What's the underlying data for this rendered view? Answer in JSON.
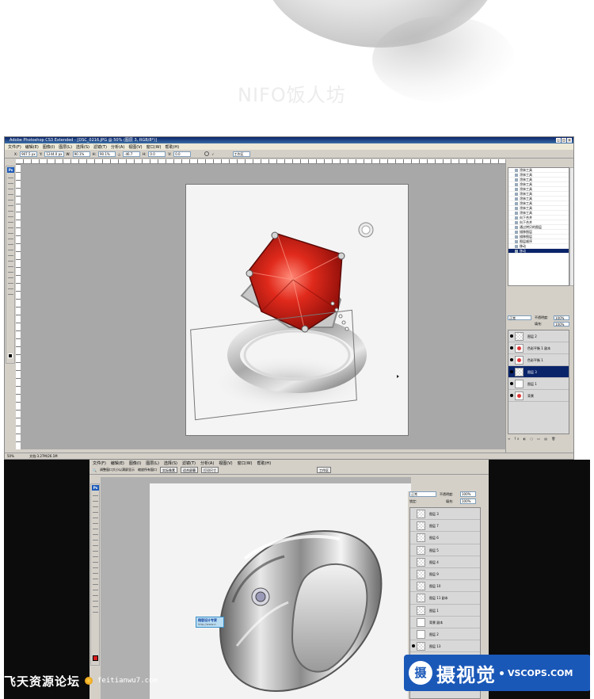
{
  "top": {
    "watermark": "NIFO饭人坊"
  },
  "ps1": {
    "title": "Adobe Photoshop CS3 Extended - [DSC_0216.JPG @ 50% (图层 3, RGB/8*)]",
    "menu": [
      "文件(F)",
      "编辑(E)",
      "图像(I)",
      "图层(L)",
      "选择(S)",
      "滤镜(T)",
      "分析(A)",
      "视图(V)",
      "窗口(W)",
      "帮助(H)"
    ],
    "options": {
      "x": "907.5 px",
      "y": "1244.0 px",
      "w": "90.1%",
      "h": "90.1%",
      "angle": "-46.7",
      "hskew": "0.0",
      "vskew": "0.0",
      "workspace": "工作区"
    },
    "history": [
      "涂抹工具",
      "涂抹工具",
      "涂抹工具",
      "涂抹工具",
      "涂抹工具",
      "涂抹工具",
      "涂抹工具",
      "涂抹工具",
      "涂抹工具",
      "涂抹工具",
      "向下合并",
      "向下合并",
      "通过拷贝的图层",
      "描移图层",
      "描移图层",
      "图层顺序",
      "移动",
      "移动"
    ],
    "layers_panel": {
      "blend_mode": "正常",
      "opacity_label": "不透明度:",
      "opacity": "100%",
      "fill_label": "填充:",
      "fill": "100%"
    },
    "layers": [
      {
        "name": "图层 2",
        "thumb": "check"
      },
      {
        "name": "色彩平衡 1 副本",
        "thumb": "red"
      },
      {
        "name": "色彩平衡 1",
        "thumb": "red"
      },
      {
        "name": "图层 3",
        "thumb": "check",
        "active": true
      },
      {
        "name": "图层 1",
        "thumb": "white"
      },
      {
        "name": "背景",
        "thumb": "red"
      }
    ],
    "status": {
      "zoom": "50%",
      "doc": "文档:3.27M/26.1M"
    }
  },
  "ps2": {
    "menu": [
      "文件(F)",
      "编辑(E)",
      "图像(I)",
      "图层(L)",
      "选择(S)",
      "滤镜(T)",
      "分析(A)",
      "视图(V)",
      "窗口(W)",
      "帮助(H)"
    ],
    "options": {
      "check1": "调整窗口大小以满屏显示",
      "check2": "缩放所有窗口",
      "btn1": "实际像素",
      "btn2": "适合屏幕",
      "btn3": "打印尺寸",
      "workspace": "工作区"
    },
    "callout": {
      "title": "翔容设计专家",
      "url": "http://www.rr"
    },
    "layers_panel": {
      "blend_mode": "正常",
      "opacity_label": "不透明度:",
      "opacity": "100%",
      "lock_label": "锁定:",
      "fill_label": "填充:",
      "fill": "100%"
    },
    "layers": [
      {
        "name": "图层 3"
      },
      {
        "name": "图层 7"
      },
      {
        "name": "图层 6"
      },
      {
        "name": "图层 5"
      },
      {
        "name": "图层 4"
      },
      {
        "name": "图层 9"
      },
      {
        "name": "图层 10"
      },
      {
        "name": "图层 11 副本"
      },
      {
        "name": "图层 1"
      },
      {
        "name": "背景 副本"
      },
      {
        "name": "图层 2"
      },
      {
        "name": "图层 13"
      }
    ]
  },
  "logos": {
    "forum_name": "飞天资源论坛",
    "forum_url": "feitianwu7.com",
    "brand_icon": "摄",
    "brand_cn": "摄视觉",
    "brand_en": "VSCOPS.COM"
  },
  "colors": {
    "ps_accent": "#0a246a",
    "ruby": "#d61c1c",
    "brand_blue": "#1a58b8"
  }
}
